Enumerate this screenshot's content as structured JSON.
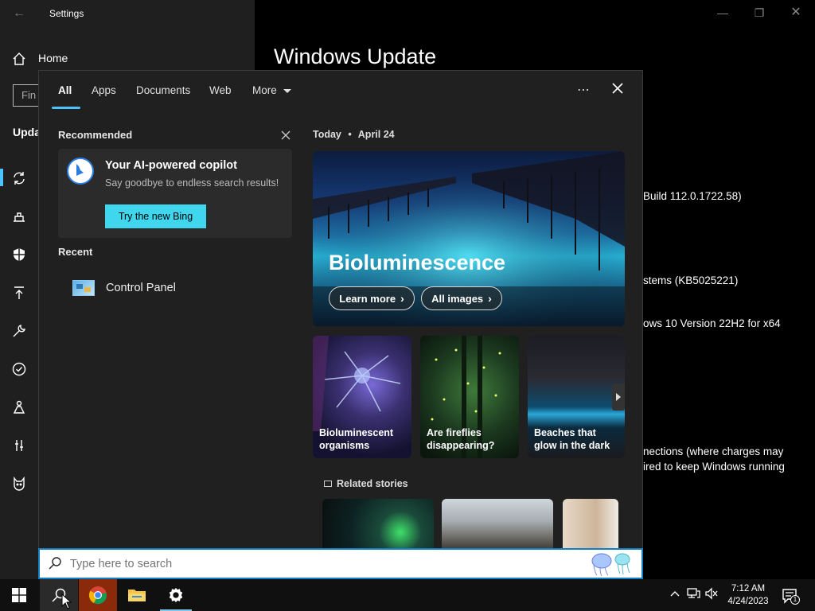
{
  "settings": {
    "title": "Settings",
    "home_label": "Home",
    "find_placeholder": "Fin",
    "section_partial": "Upda",
    "page_title": "Windows Update",
    "bg_lines": [
      "Build 112.0.1722.58)",
      "stems (KB5025221)",
      "ows 10 Version 22H2 for x64",
      "nections (where charges may",
      "ired to keep Windows running"
    ]
  },
  "search": {
    "tabs": [
      "All",
      "Apps",
      "Documents",
      "Web",
      "More"
    ],
    "more_icon": "ellipsis-icon",
    "recommended_label": "Recommended",
    "copilot_title": "Your AI-powered copilot",
    "copilot_subtitle": "Say goodbye to endless search results!",
    "bing_button": "Try the new Bing",
    "recent_label": "Recent",
    "recent_items": [
      {
        "label": "Control Panel",
        "icon": "control-panel-icon"
      }
    ],
    "today_label": "Today",
    "today_date": "April 24",
    "hero_title": "Bioluminescence",
    "learn_more": "Learn more",
    "all_images": "All images",
    "tiles": [
      {
        "label_line1": "Bioluminescent",
        "label_line2": "organisms"
      },
      {
        "label_line1": "Are fireflies",
        "label_line2": "disappearing?"
      },
      {
        "label_line1": "Beaches that",
        "label_line2": "glow in the dark"
      }
    ],
    "related_label": "Related stories",
    "placeholder": "Type here to search"
  },
  "taskbar": {
    "time": "7:12 AM",
    "date": "4/24/2023",
    "notification_count": "1"
  },
  "colors": {
    "accent": "#4cc2ff",
    "bing_button": "#3fd6ee",
    "panel_bg": "#202020",
    "search_border": "#0f7ec3"
  }
}
